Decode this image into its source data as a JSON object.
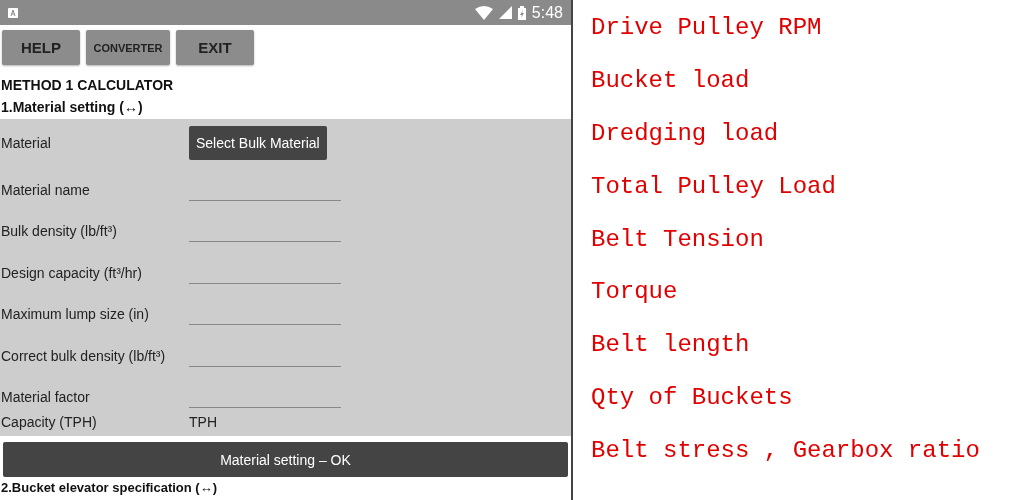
{
  "status_bar": {
    "time": "5:48"
  },
  "toolbar": [
    "HELP",
    "CONVERTER",
    "EXIT"
  ],
  "title": "METHOD 1 CALCULATOR",
  "section_1": {
    "heading": "1.Material setting (↔)",
    "rows": [
      {
        "label": "Material",
        "kind": "button",
        "text": "Select Bulk Material"
      },
      {
        "label": "Material name",
        "kind": "field"
      },
      {
        "label": "Bulk density (lb/ft³)",
        "kind": "field"
      },
      {
        "label": "Design capacity (ft³/hr)",
        "kind": "field"
      },
      {
        "label": "Maximum lump size (in)",
        "kind": "field"
      },
      {
        "label": "Correct bulk density (lb/ft³)",
        "kind": "field"
      },
      {
        "label": "Material factor",
        "kind": "field"
      },
      {
        "label": "Capacity (TPH)",
        "kind": "value",
        "text": "TPH"
      }
    ],
    "ok_button": "Material setting – OK"
  },
  "section_2": {
    "heading": "2.Bucket elevator specification (↔)"
  },
  "features": [
    "Drive Pulley RPM",
    "Bucket load",
    "Dredging load",
    "Total Pulley Load",
    "Belt Tension",
    "Torque",
    "Belt length",
    "Qty of Buckets",
    "Belt stress , Gearbox ratio"
  ]
}
